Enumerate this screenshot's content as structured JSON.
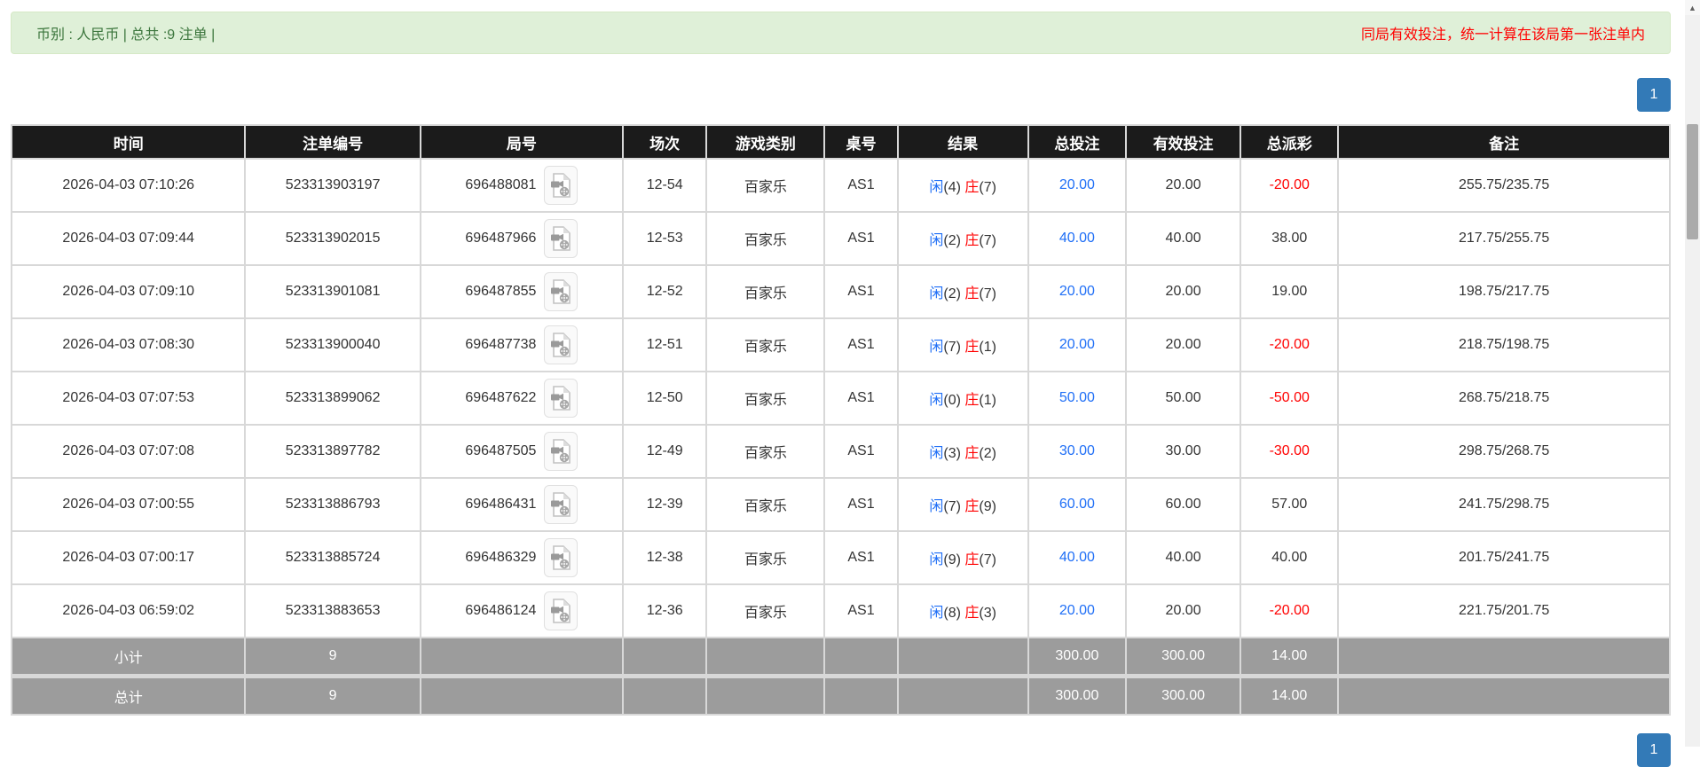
{
  "alert": {
    "left": "币别 : 人民币 | 总共 :9 注单 |",
    "right": "同局有效投注，统一计算在该局第一张注单内"
  },
  "pagination": {
    "page": "1"
  },
  "colors": {
    "accent_blue": "#1e6ef6",
    "negative_red": "#ff0000",
    "alert_green_text": "#3c763d",
    "alert_green_bg": "#dff0d8",
    "header_bg": "#1b1b1b",
    "summary_bg": "#9c9c9c",
    "pager_blue": "#337ab7"
  },
  "table": {
    "headers": [
      "时间",
      "注单编号",
      "局号",
      "场次",
      "游戏类别",
      "桌号",
      "结果",
      "总投注",
      "有效投注",
      "总派彩",
      "备注"
    ],
    "icons": {
      "round_video": "video-icon"
    },
    "rows": [
      {
        "time": "2026-04-03 07:10:26",
        "bet_id": "523313903197",
        "round_id": "696488081",
        "session": "12-54",
        "game": "百家乐",
        "table_no": "AS1",
        "result": {
          "p_label": "闲",
          "p_score": "(4)",
          "b_label": "庄",
          "b_score": "(7)"
        },
        "total_bet": "20.00",
        "valid_bet": "20.00",
        "payout": "-20.00",
        "remark": "255.75/235.75"
      },
      {
        "time": "2026-04-03 07:09:44",
        "bet_id": "523313902015",
        "round_id": "696487966",
        "session": "12-53",
        "game": "百家乐",
        "table_no": "AS1",
        "result": {
          "p_label": "闲",
          "p_score": "(2)",
          "b_label": "庄",
          "b_score": "(7)"
        },
        "total_bet": "40.00",
        "valid_bet": "40.00",
        "payout": "38.00",
        "remark": "217.75/255.75"
      },
      {
        "time": "2026-04-03 07:09:10",
        "bet_id": "523313901081",
        "round_id": "696487855",
        "session": "12-52",
        "game": "百家乐",
        "table_no": "AS1",
        "result": {
          "p_label": "闲",
          "p_score": "(2)",
          "b_label": "庄",
          "b_score": "(7)"
        },
        "total_bet": "20.00",
        "valid_bet": "20.00",
        "payout": "19.00",
        "remark": "198.75/217.75"
      },
      {
        "time": "2026-04-03 07:08:30",
        "bet_id": "523313900040",
        "round_id": "696487738",
        "session": "12-51",
        "game": "百家乐",
        "table_no": "AS1",
        "result": {
          "p_label": "闲",
          "p_score": "(7)",
          "b_label": "庄",
          "b_score": "(1)"
        },
        "total_bet": "20.00",
        "valid_bet": "20.00",
        "payout": "-20.00",
        "remark": "218.75/198.75"
      },
      {
        "time": "2026-04-03 07:07:53",
        "bet_id": "523313899062",
        "round_id": "696487622",
        "session": "12-50",
        "game": "百家乐",
        "table_no": "AS1",
        "result": {
          "p_label": "闲",
          "p_score": "(0)",
          "b_label": "庄",
          "b_score": "(1)"
        },
        "total_bet": "50.00",
        "valid_bet": "50.00",
        "payout": "-50.00",
        "remark": "268.75/218.75"
      },
      {
        "time": "2026-04-03 07:07:08",
        "bet_id": "523313897782",
        "round_id": "696487505",
        "session": "12-49",
        "game": "百家乐",
        "table_no": "AS1",
        "result": {
          "p_label": "闲",
          "p_score": "(3)",
          "b_label": "庄",
          "b_score": "(2)"
        },
        "total_bet": "30.00",
        "valid_bet": "30.00",
        "payout": "-30.00",
        "remark": "298.75/268.75"
      },
      {
        "time": "2026-04-03 07:00:55",
        "bet_id": "523313886793",
        "round_id": "696486431",
        "session": "12-39",
        "game": "百家乐",
        "table_no": "AS1",
        "result": {
          "p_label": "闲",
          "p_score": "(7)",
          "b_label": "庄",
          "b_score": "(9)"
        },
        "total_bet": "60.00",
        "valid_bet": "60.00",
        "payout": "57.00",
        "remark": "241.75/298.75"
      },
      {
        "time": "2026-04-03 07:00:17",
        "bet_id": "523313885724",
        "round_id": "696486329",
        "session": "12-38",
        "game": "百家乐",
        "table_no": "AS1",
        "result": {
          "p_label": "闲",
          "p_score": "(9)",
          "b_label": "庄",
          "b_score": "(7)"
        },
        "total_bet": "40.00",
        "valid_bet": "40.00",
        "payout": "40.00",
        "remark": "201.75/241.75"
      },
      {
        "time": "2026-04-03 06:59:02",
        "bet_id": "523313883653",
        "round_id": "696486124",
        "session": "12-36",
        "game": "百家乐",
        "table_no": "AS1",
        "result": {
          "p_label": "闲",
          "p_score": "(8)",
          "b_label": "庄",
          "b_score": "(3)"
        },
        "total_bet": "20.00",
        "valid_bet": "20.00",
        "payout": "-20.00",
        "remark": "221.75/201.75"
      }
    ],
    "subtotal": {
      "label": "小计",
      "count": "9",
      "total_bet": "300.00",
      "valid_bet": "300.00",
      "payout": "14.00"
    },
    "total": {
      "label": "总计",
      "count": "9",
      "total_bet": "300.00",
      "valid_bet": "300.00",
      "payout": "14.00"
    }
  }
}
